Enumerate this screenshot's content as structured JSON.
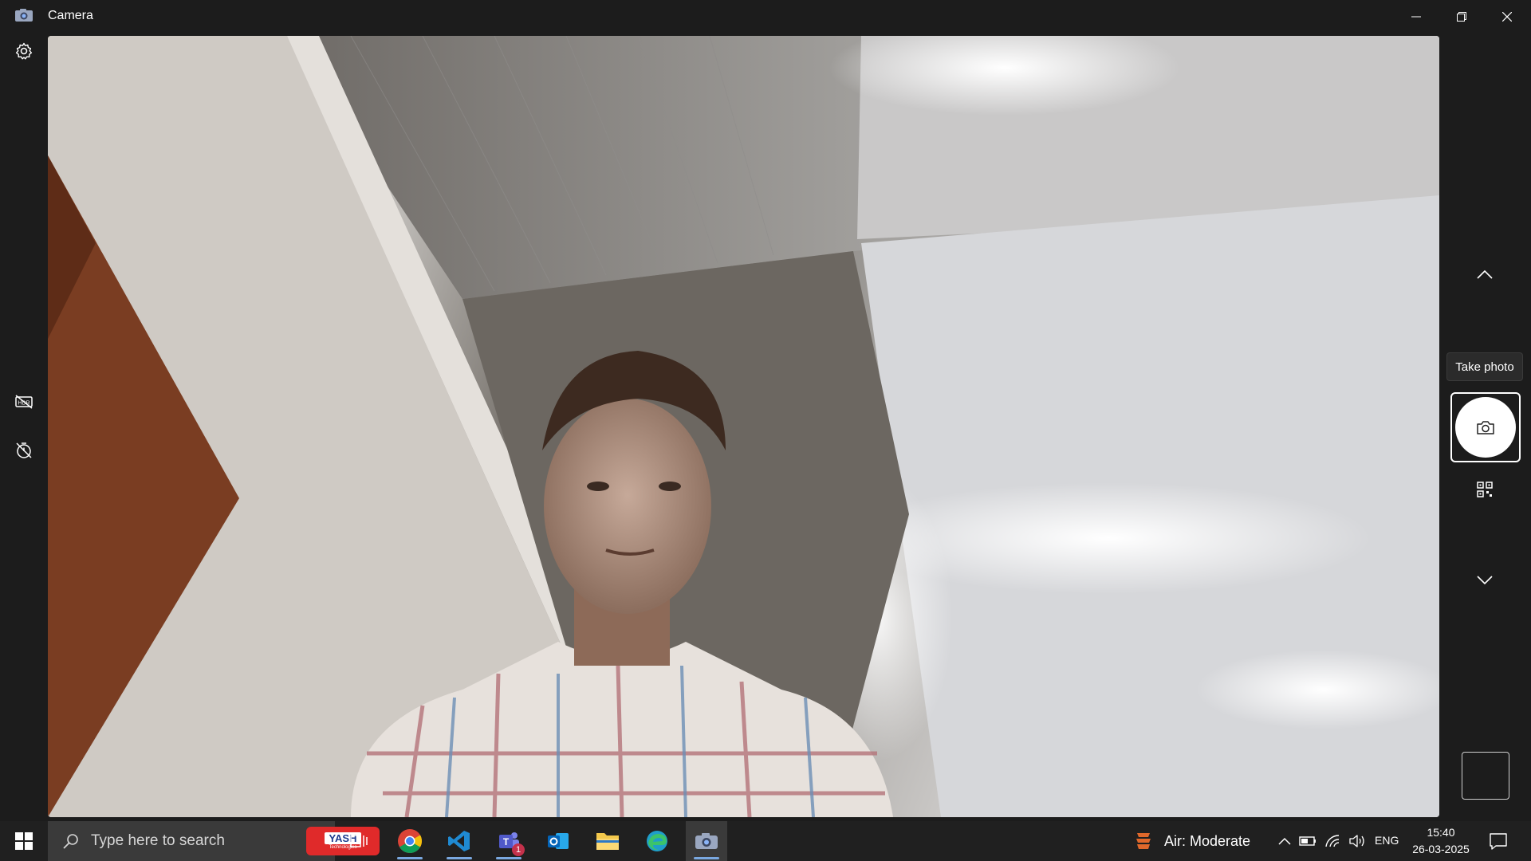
{
  "window": {
    "title": "Camera"
  },
  "controls": {
    "tooltip": "Take photo"
  },
  "taskbar": {
    "search_placeholder": "Type here to search",
    "search_badge_text": "YASH",
    "search_badge_subtext": "Technologies",
    "pinned_apps": [
      "task-view",
      "chrome",
      "vscode",
      "teams",
      "outlook",
      "file-explorer",
      "edge",
      "camera"
    ],
    "teams_badge_count": "1",
    "weather": "Air: Moderate",
    "language": "ENG",
    "time": "15:40",
    "date": "26-03-2025"
  }
}
